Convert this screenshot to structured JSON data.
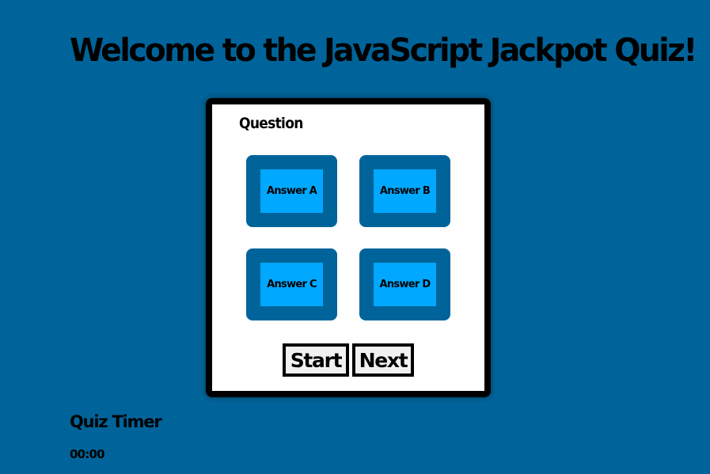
{
  "header": {
    "title": "Welcome to the JavaScript Jackpot Quiz!"
  },
  "quiz": {
    "question": "Question",
    "answers": [
      "Answer A",
      "Answer B",
      "Answer C",
      "Answer D"
    ],
    "controls": {
      "start_label": "Start",
      "next_label": "Next"
    }
  },
  "timer": {
    "label": "Quiz Timer",
    "value": "00:00"
  },
  "colors": {
    "background": "#00649a",
    "answer_tile": "#00649a",
    "answer_button": "#00a8ff",
    "card": "#ffffff",
    "card_border": "#000000"
  }
}
